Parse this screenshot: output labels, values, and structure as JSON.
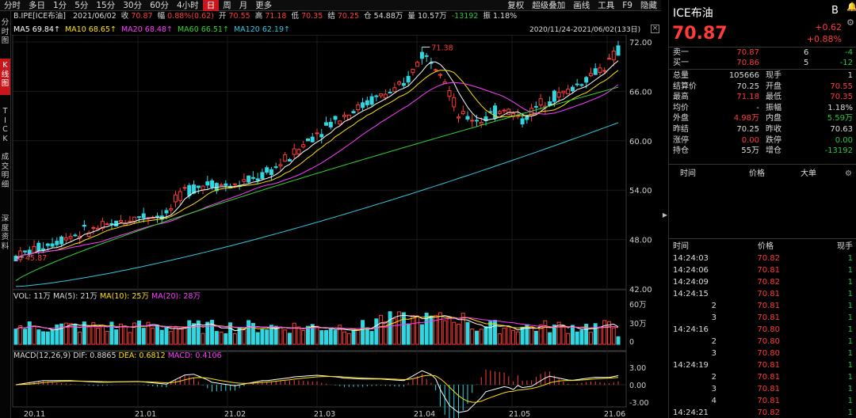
{
  "top_tabs": [
    {
      "label": "分时",
      "active": false
    },
    {
      "label": "多日",
      "active": false
    },
    {
      "label": "1分",
      "active": false
    },
    {
      "label": "5分",
      "active": false
    },
    {
      "label": "15分",
      "active": false
    },
    {
      "label": "30分",
      "active": false
    },
    {
      "label": "60分",
      "active": false
    },
    {
      "label": "4小时",
      "active": false
    },
    {
      "label": "日",
      "active": true
    },
    {
      "label": "周",
      "active": false
    },
    {
      "label": "月",
      "active": false
    },
    {
      "label": "更多",
      "active": false
    }
  ],
  "top_right": [
    "复权",
    "超级叠加",
    "画线",
    "工具",
    "F9",
    "隐藏"
  ],
  "left_nav": [
    {
      "label": "分\n时\n图",
      "active": false
    },
    {
      "label": "K\n线\n图",
      "active": true
    },
    {
      "label": "T\nI\nC\nK",
      "active": false
    },
    {
      "label": "成\n交\n明\n细",
      "active": false
    },
    {
      "label": "深\n度\n资\n料",
      "active": false
    }
  ],
  "info": {
    "symbol": "B.IPE[ICE布油]",
    "date": "2021/06/02",
    "close_label": "收",
    "close": "70.87",
    "chg_label": "幅",
    "chg": "0.88%(0.62)",
    "open_label": "开",
    "open": "70.55",
    "high_label": "高",
    "high": "71.18",
    "low_label": "低",
    "low": "70.35",
    "settle_label": "结",
    "settle": "70.25",
    "oi_label": "仓",
    "oi": "54.88万",
    "vol_label": "量",
    "vol": "10.57万",
    "diff": "-13192",
    "amp_label": "振",
    "amp": "1.18%"
  },
  "ma_line": [
    {
      "label": "MA5",
      "value": "69.84↑",
      "color": "#ffffff"
    },
    {
      "label": "MA10",
      "value": "68.65↑",
      "color": "#ffe000"
    },
    {
      "label": "MA20",
      "value": "68.48↑",
      "color": "#ff3cff"
    },
    {
      "label": "MA60",
      "value": "66.51↑",
      "color": "#2fd82f"
    },
    {
      "label": "MA120",
      "value": "62.19↑",
      "color": "#30c8e0"
    }
  ],
  "period": "2020/11/24-2021/06/02(133日)",
  "price_axis": [
    "72.00",
    "66.00",
    "60.00",
    "54.00",
    "48.00",
    "42.00"
  ],
  "hi_mark": "71.38",
  "lo_mark": "45.87",
  "vol_info": {
    "label": "VOL: 11万",
    "ma5": "MA(5): 21万",
    "ma10": "MA(10): 25万",
    "ma20": "MA(20): 28万"
  },
  "vol_axis": [
    "60万",
    "30万",
    "0"
  ],
  "macd_info": {
    "label": "MACD(12,26,9)",
    "dif": "DIF: 0.8865",
    "dea": "DEA: 0.6812",
    "macd": "MACD: 0.4106"
  },
  "macd_axis": [
    "3.00",
    "0.00",
    "-3.00"
  ],
  "x_axis": [
    "20.11",
    "21.01",
    "21.02",
    "21.03",
    "21.04",
    "21.05",
    "21.06"
  ],
  "chart_data": {
    "type": "candlestick",
    "x_start": "2020/11/24",
    "x_end": "2021/06/02",
    "bars": 133,
    "ylim": [
      42,
      72
    ],
    "last": {
      "open": 70.55,
      "high": 71.18,
      "low": 70.35,
      "close": 70.87
    },
    "high_mark": 71.38,
    "low_mark": 45.87
  },
  "rp": {
    "title": "ICE布油",
    "tag": "B",
    "price": "70.87",
    "chg": "+0.62",
    "pct": "+0.88%",
    "book": [
      {
        "l": "卖一",
        "p": "70.87",
        "q": "6",
        "d": "-4"
      },
      {
        "l": "买一",
        "p": "70.86",
        "q": "5",
        "d": "-12"
      }
    ],
    "stats": [
      {
        "l1": "总量",
        "v1": "105666",
        "c1": "w",
        "l2": "现手",
        "v2": "1",
        "c2": "w"
      },
      {
        "l1": "结算价",
        "v1": "70.25",
        "c1": "w",
        "l2": "开盘",
        "v2": "70.55",
        "c2": "r"
      },
      {
        "l1": "最高",
        "v1": "71.18",
        "c1": "r",
        "l2": "最低",
        "v2": "70.35",
        "c2": "r"
      },
      {
        "l1": "均价",
        "v1": "-",
        "c1": "w",
        "l2": "振幅",
        "v2": "1.18%",
        "c2": "w"
      },
      {
        "l1": "外盘",
        "v1": "4.98万",
        "c1": "r",
        "l2": "内盘",
        "v2": "5.59万",
        "c2": "g"
      },
      {
        "l1": "昨结",
        "v1": "70.25",
        "c1": "w",
        "l2": "昨收",
        "v2": "70.63",
        "c2": "w"
      },
      {
        "l1": "涨停",
        "v1": "0.00",
        "c1": "r",
        "l2": "跌停",
        "v2": "0.00",
        "c2": "g"
      },
      {
        "l1": "持仓",
        "v1": "55万",
        "c1": "w",
        "l2": "增仓",
        "v2": "-13192",
        "c2": "g"
      }
    ],
    "hdr1": {
      "t": "时间",
      "p": "价格",
      "v": "大单"
    },
    "hdr2": {
      "t": "时间",
      "p": "价格",
      "v": "现手"
    },
    "ticks": [
      {
        "t": "14:24:03",
        "p": "70.82",
        "v": "1"
      },
      {
        "t": "14:24:06",
        "p": "70.81",
        "v": "1"
      },
      {
        "t": "14:24:09",
        "p": "70.82",
        "v": "1"
      },
      {
        "t": "14:24:15",
        "p": "70.81",
        "v": "1"
      },
      {
        "t": "2",
        "p": "70.81",
        "v": "1"
      },
      {
        "t": "3",
        "p": "70.81",
        "v": "1"
      },
      {
        "t": "14:24:16",
        "p": "70.80",
        "v": "1"
      },
      {
        "t": "2",
        "p": "70.80",
        "v": "1"
      },
      {
        "t": "3",
        "p": "70.80",
        "v": "1"
      },
      {
        "t": "14:24:19",
        "p": "70.81",
        "v": "1"
      },
      {
        "t": "2",
        "p": "70.81",
        "v": "1"
      },
      {
        "t": "3",
        "p": "70.81",
        "v": "1"
      },
      {
        "t": "4",
        "p": "70.81",
        "v": "1"
      },
      {
        "t": "14:24:21",
        "p": "70.82",
        "v": "1"
      }
    ]
  }
}
